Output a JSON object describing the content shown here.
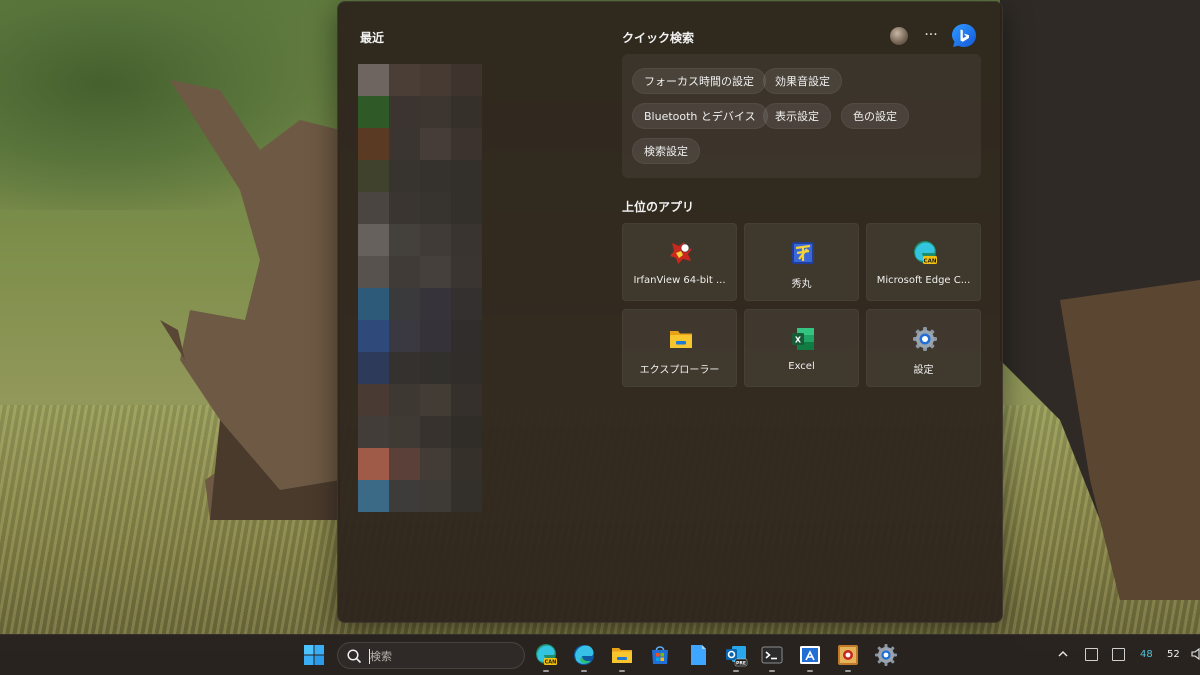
{
  "flyout": {
    "recent_title": "最近",
    "quick_search": {
      "title": "クイック検索",
      "more_label": "···",
      "chips": [
        {
          "label": "フォーカス時間の設定"
        },
        {
          "label": "効果音設定"
        },
        {
          "label": "Bluetooth とデバイス"
        },
        {
          "label": "表示設定"
        },
        {
          "label": "色の設定"
        },
        {
          "label": "検索設定"
        }
      ]
    },
    "top_apps": {
      "title": "上位のアプリ",
      "apps": [
        {
          "label": "IrfanView 64-bit ...",
          "icon": "irfanview-icon"
        },
        {
          "label": "秀丸",
          "icon": "hidemaru-icon"
        },
        {
          "label": "Microsoft Edge C...",
          "icon": "edge-canary-icon"
        },
        {
          "label": "エクスプローラー",
          "icon": "file-explorer-icon"
        },
        {
          "label": "Excel",
          "icon": "excel-icon"
        },
        {
          "label": "設定",
          "icon": "settings-icon"
        }
      ]
    }
  },
  "taskbar": {
    "search_placeholder": "検索",
    "pinned": [
      "edge-canary-icon",
      "edge-icon",
      "file-explorer-icon",
      "store-icon",
      "notepad-icon",
      "outlook-icon",
      "terminal-icon",
      "snipping-icon",
      "irfanview-icon",
      "settings-icon"
    ],
    "tray": {
      "num_a": "48",
      "num_b": "52"
    }
  },
  "colors": {
    "accent": "#60cdff",
    "flyout_bg": "#2c221c",
    "taskbar_bg": "#26211e",
    "tray_accent": "#4fc3d8"
  }
}
